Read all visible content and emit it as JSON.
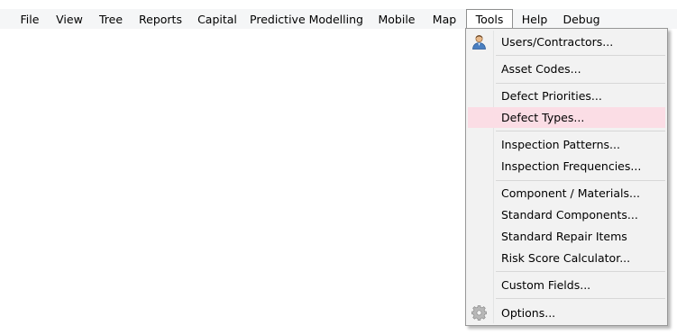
{
  "menubar": {
    "items": [
      {
        "label": "File"
      },
      {
        "label": "View"
      },
      {
        "label": "Tree"
      },
      {
        "label": "Reports"
      },
      {
        "label": "Capital"
      },
      {
        "label": "Predictive Modelling"
      },
      {
        "label": "Mobile"
      },
      {
        "label": "Map"
      },
      {
        "label": "Tools"
      },
      {
        "label": "Help"
      },
      {
        "label": "Debug"
      }
    ],
    "open_menu": "Tools"
  },
  "tools_menu": {
    "items": [
      {
        "label": "Users/Contractors...",
        "icon": "user-icon"
      },
      {
        "label": "Asset Codes..."
      },
      {
        "label": "Defect Priorities..."
      },
      {
        "label": "Defect Types...",
        "highlighted": true
      },
      {
        "label": "Inspection Patterns..."
      },
      {
        "label": "Inspection Frequencies..."
      },
      {
        "label": "Component / Materials..."
      },
      {
        "label": "Standard Components..."
      },
      {
        "label": "Standard Repair Items"
      },
      {
        "label": "Risk Score Calculator..."
      },
      {
        "label": "Custom Fields..."
      },
      {
        "label": "Options...",
        "icon": "gear-icon"
      }
    ]
  },
  "colors": {
    "menubar_bg": "#f5f6f7",
    "dropdown_bg": "#f2f2f2",
    "highlight": "#fbdde5"
  }
}
